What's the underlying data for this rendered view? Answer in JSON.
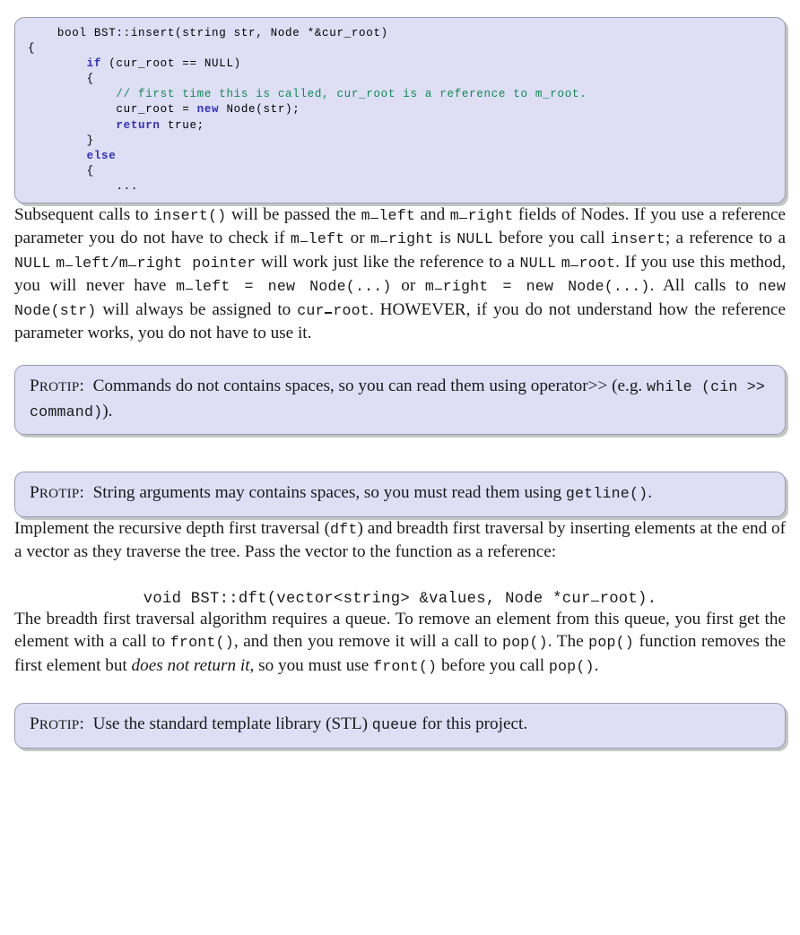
{
  "document": {
    "type": "latex-assignment-page",
    "background_color": "#ffffff",
    "text_color": "#1a1a1a"
  },
  "code_block": {
    "background_color": "#dedef5",
    "border_color": "#9a9ab0",
    "keyword_color": "#2f2fbf",
    "comment_color": "#0e8a4e",
    "lines": [
      {
        "indent": 1,
        "segments": [
          {
            "t": "bool BST::insert(string str, Node *&cur_root)",
            "k": "plain"
          }
        ]
      },
      {
        "indent": 0,
        "segments": [
          {
            "t": "{",
            "k": "plain"
          }
        ]
      },
      {
        "indent": 2,
        "segments": [
          {
            "t": "if",
            "k": "kw"
          },
          {
            "t": " (cur_root == NULL)",
            "k": "plain"
          }
        ]
      },
      {
        "indent": 2,
        "segments": [
          {
            "t": "{",
            "k": "plain"
          }
        ]
      },
      {
        "indent": 3,
        "segments": [
          {
            "t": "// first time this is called, cur_root is a reference to m_root.",
            "k": "cmt"
          }
        ]
      },
      {
        "indent": 3,
        "segments": [
          {
            "t": "cur_root = ",
            "k": "plain"
          },
          {
            "t": "new",
            "k": "kw"
          },
          {
            "t": " Node(str);",
            "k": "plain"
          }
        ]
      },
      {
        "indent": 3,
        "segments": [
          {
            "t": "return",
            "k": "kw"
          },
          {
            "t": " true;",
            "k": "plain"
          }
        ]
      },
      {
        "indent": 2,
        "segments": [
          {
            "t": "}",
            "k": "plain"
          }
        ]
      },
      {
        "indent": 2,
        "segments": [
          {
            "t": "else",
            "k": "kw"
          }
        ]
      },
      {
        "indent": 2,
        "segments": [
          {
            "t": "{",
            "k": "plain"
          }
        ]
      },
      {
        "indent": 3,
        "segments": [
          {
            "t": "...",
            "k": "plain"
          }
        ]
      }
    ]
  },
  "paragraph_1": {
    "text": "Subsequent calls to insert() will be passed the m_left and m_right fields of Nodes. If you use a reference parameter you do not have to check if m_left or m_right is NULL before you call insert; a reference to a NULL m_left/m_right pointer will work just like the reference to a NULL m_root. If you use this method, you will never have m_left = new Node(...) or m_right = new Node(...). All calls to new Node(str) will always be assigned to cur_root. HOWEVER, if you do not understand how the reference parameter works, you do not have to use it."
  },
  "protip_1": {
    "label": "Protip:",
    "text": "Commands do not contains spaces, so you can read them using operator>> (e.g. while (cin >> command))."
  },
  "protip_2": {
    "label": "Protip:",
    "text": "String arguments may contains spaces, so you must read them using getline()."
  },
  "paragraph_2": {
    "text": "Implement the recursive depth first traversal (dft) and breadth first traversal by inserting elements at the end of a vector as they traverse the tree. Pass the vector to the function as a reference:"
  },
  "display_signature": {
    "text": "void BST::dft(vector<string> &values, Node *cur_root)."
  },
  "paragraph_3": {
    "text": "The breadth first traversal algorithm requires a queue. To remove an element from this queue, you first get the element with a call to front(), and then you remove it will a call to pop(). The pop() function removes the first element but does not return it, so you must use front() before you call pop()."
  },
  "protip_3": {
    "label": "Protip:",
    "text": "Use the standard template library (STL) queue for this project."
  }
}
